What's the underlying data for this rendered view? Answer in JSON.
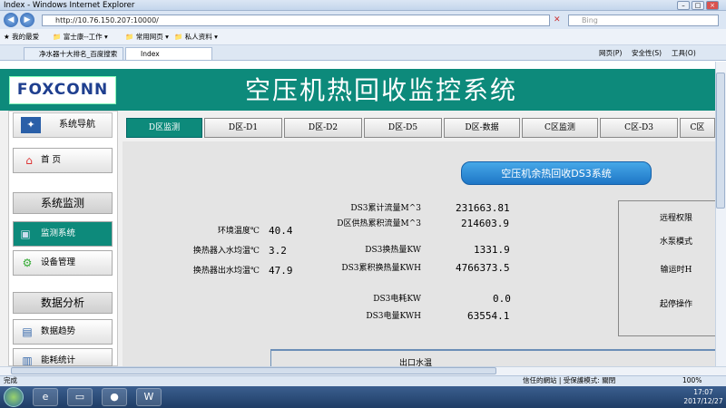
{
  "browser": {
    "title": "Index - Windows Internet Explorer",
    "url": "http://10.76.150.207:10000/",
    "search_placeholder": "Bing",
    "favorites": [
      "我的最爱",
      "富士康--工作",
      "常用网页",
      "私人资料"
    ],
    "tabs": [
      "净水器十大排名_百度搜索",
      "Index"
    ],
    "tools": [
      "网页(P)",
      "安全性(S)",
      "工具(O)"
    ],
    "status_left": "完成",
    "status_zone": "信任的網站 | 受保護模式: 關閉",
    "zoom": "100%"
  },
  "header": {
    "logo": "FOXCONN",
    "title": "空压机热回收监控系统"
  },
  "sidebar": {
    "nav_title": "系统导航",
    "home": "首 页",
    "section_monitor": "系统监测",
    "monitor_system": "监测系统",
    "device_mgmt": "设备管理",
    "section_analysis": "数据分析",
    "data_trend": "数据趋势",
    "energy_stats": "能耗统计"
  },
  "tabs": [
    "D区监测",
    "D区-D1",
    "D区-D2",
    "D区-D5",
    "D区-数据",
    "C区监测",
    "C区-D3",
    "C区"
  ],
  "system_title": "空压机余热回收DS3系统",
  "left_metrics": [
    {
      "label": "环境温度℃",
      "value": "40.4"
    },
    {
      "label": "换热器入水均温℃",
      "value": "3.2"
    },
    {
      "label": "换热器出水均温℃",
      "value": "47.9"
    }
  ],
  "mid_metrics": [
    {
      "label": "DS3累计流量M^3",
      "value": "231663.81"
    },
    {
      "label": "D区供热累积流量M^3",
      "value": "214603.9"
    },
    {
      "label": "DS3换热量KW",
      "value": "1331.9"
    },
    {
      "label": "DS3累积换热量KWH",
      "value": "4766373.5"
    },
    {
      "label": "DS3电耗KW",
      "value": "0.0"
    },
    {
      "label": "DS3电量KWH",
      "value": "63554.1"
    }
  ],
  "right_labels": [
    "远程权限",
    "水泵模式",
    "输运时H",
    "起停操作"
  ],
  "bottom_text": "出口水温",
  "clock": {
    "time": "17:07",
    "date": "2017/12/27"
  }
}
